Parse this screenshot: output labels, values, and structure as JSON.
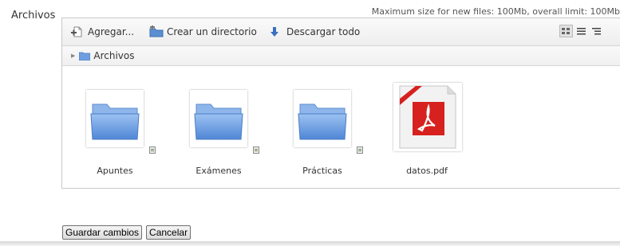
{
  "field_label": "Archivos",
  "limit_note": "Maximum size for new files: 100Mb, overall limit: 100Mb",
  "toolbar": {
    "add_label": "Agregar...",
    "mkdir_label": "Crear un directorio",
    "download_label": "Descargar todo"
  },
  "breadcrumb": {
    "current": "Archivos"
  },
  "files": [
    {
      "name": "Apuntes",
      "type": "folder"
    },
    {
      "name": "Exámenes",
      "type": "folder"
    },
    {
      "name": "Prácticas",
      "type": "folder"
    },
    {
      "name": "datos.pdf",
      "type": "pdf"
    }
  ],
  "buttons": {
    "save": "Guardar cambios",
    "cancel": "Cancelar"
  },
  "colors": {
    "folder": "#6f9ee0",
    "pdf_red": "#d6211e",
    "border": "#c8c8c8"
  }
}
